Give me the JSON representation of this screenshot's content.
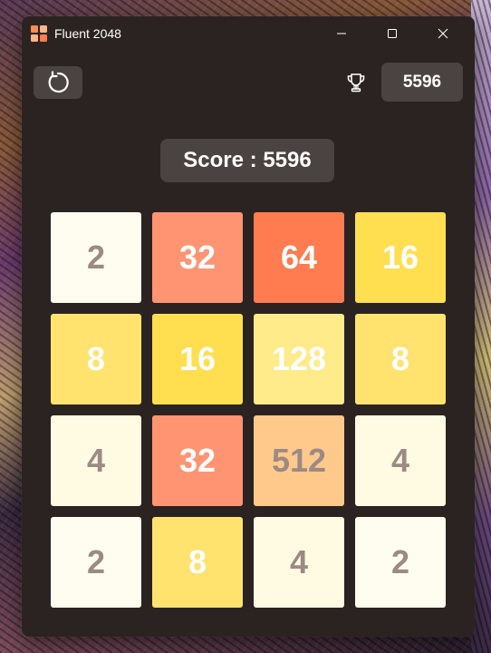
{
  "window": {
    "title": "Fluent 2048",
    "controls": {
      "minimize": "minimize-icon",
      "maximize": "maximize-icon",
      "close": "close-icon"
    }
  },
  "toolbar": {
    "restart_icon": "restart-icon",
    "trophy_icon": "trophy-icon",
    "best_score": "5596"
  },
  "score": {
    "label": "Score : 5596"
  },
  "board": {
    "rows": [
      [
        "2",
        "32",
        "64",
        "16"
      ],
      [
        "8",
        "16",
        "128",
        "8"
      ],
      [
        "4",
        "32",
        "512",
        "4"
      ],
      [
        "2",
        "8",
        "4",
        "2"
      ]
    ]
  },
  "colors": {
    "window_bg": "#2b2321",
    "button_bg": "#4a4341",
    "tile_2": "#fffdf0",
    "tile_4": "#fffbe3",
    "tile_8": "#ffe36e",
    "tile_16": "#ffdf50",
    "tile_32": "#ff9472",
    "tile_64": "#ff7b50",
    "tile_128": "#ffeb8a",
    "tile_512": "#ffc98c",
    "dark_text": "#9c8a83",
    "light_text": "#ffffff"
  }
}
